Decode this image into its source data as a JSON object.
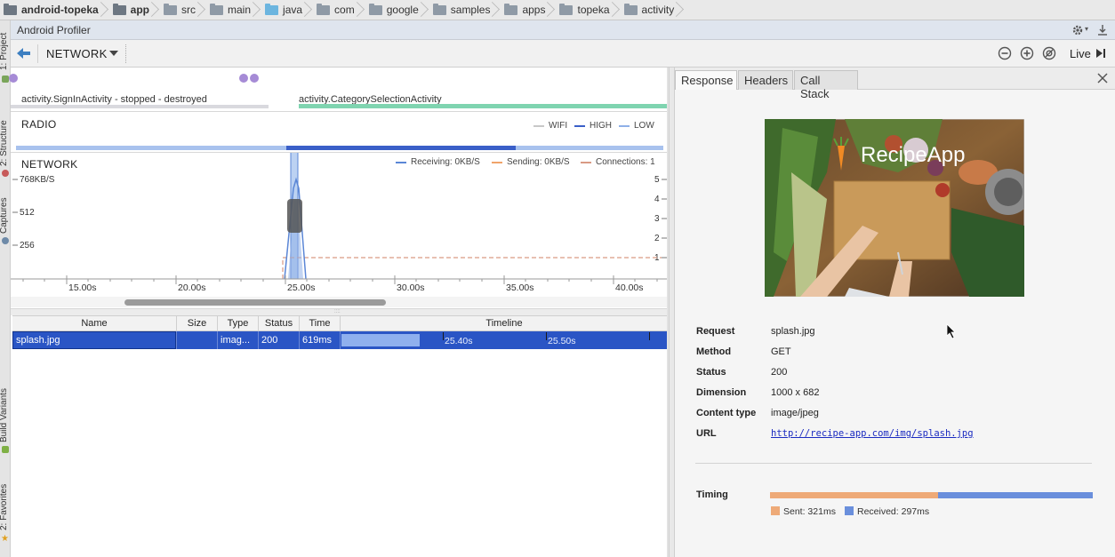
{
  "breadcrumbs": [
    {
      "label": "android-topeka",
      "icon": "folder-icon",
      "bold": true
    },
    {
      "label": "app",
      "icon": "folder-icon",
      "bold": true
    },
    {
      "label": "src",
      "icon": "folder-icon"
    },
    {
      "label": "main",
      "icon": "folder-icon"
    },
    {
      "label": "java",
      "icon": "folder-icon"
    },
    {
      "label": "com",
      "icon": "folder-icon"
    },
    {
      "label": "google",
      "icon": "folder-icon"
    },
    {
      "label": "samples",
      "icon": "folder-icon"
    },
    {
      "label": "apps",
      "icon": "folder-icon"
    },
    {
      "label": "topeka",
      "icon": "folder-icon"
    },
    {
      "label": "activity",
      "icon": "folder-icon"
    }
  ],
  "side_tabs": {
    "project": "1: Project",
    "structure": "2: Structure",
    "captures": "Captures",
    "build_variants": "Build Variants",
    "favorites": "2: Favorites"
  },
  "window": {
    "title": "Android Profiler"
  },
  "toolbar": {
    "profiler": "NETWORK",
    "live": "Live",
    "icons": [
      "back-arrow-icon",
      "chevron-down-icon",
      "zoom-out-icon",
      "zoom-in-icon",
      "reset-zoom-icon",
      "play-icon",
      "gear-icon",
      "pin-icon"
    ]
  },
  "activities": {
    "first": "activity.SignInActivity - stopped - destroyed",
    "second": "activity.CategorySelectionActivity"
  },
  "radio": {
    "title": "RADIO",
    "legend": [
      "WIFI",
      "HIGH",
      "LOW"
    ],
    "colors": {
      "wifi": "#c8c8c8",
      "high": "#3a5fc8",
      "low": "#8fb0e8"
    }
  },
  "network": {
    "title": "NETWORK",
    "legend": {
      "receiving": "Receiving: 0KB/S",
      "sending": "Sending: 0KB/S",
      "connections": "Connections: 1"
    },
    "y_left": [
      "768KB/S",
      "512",
      "256"
    ],
    "y_right": [
      "5",
      "4",
      "3",
      "2",
      "1"
    ],
    "x_ticks": [
      "15.00s",
      "20.00s",
      "25.00s",
      "30.00s",
      "35.00s",
      "40.00s"
    ],
    "colors": {
      "receiving": "#5a86d6",
      "sending": "#f0a46a",
      "connections": "#d99a84"
    }
  },
  "table": {
    "columns": [
      "Name",
      "Size",
      "Type",
      "Status",
      "Time",
      "Timeline"
    ],
    "rows": [
      {
        "name": "splash.jpg",
        "size": "",
        "type": "imag...",
        "status": "200",
        "time": "619ms",
        "ticks": [
          "25.40s",
          "25.50s"
        ]
      }
    ]
  },
  "detail": {
    "tabs": [
      "Response",
      "Headers",
      "Call Stack"
    ],
    "image_caption": "RecipeApp",
    "fields": [
      {
        "label": "Request",
        "value": "splash.jpg"
      },
      {
        "label": "Method",
        "value": "GET"
      },
      {
        "label": "Status",
        "value": "200"
      },
      {
        "label": "Dimension",
        "value": "1000 x 682"
      },
      {
        "label": "Content type",
        "value": "image/jpeg"
      },
      {
        "label": "URL",
        "value": "http://recipe-app.com/img/splash.jpg"
      }
    ],
    "timing": {
      "label": "Timing",
      "sent": "Sent: 321ms",
      "received": "Received: 297ms",
      "sent_ms": 321,
      "received_ms": 297,
      "colors": {
        "sent": "#eeaa78",
        "received": "#6a8fdc"
      }
    }
  }
}
